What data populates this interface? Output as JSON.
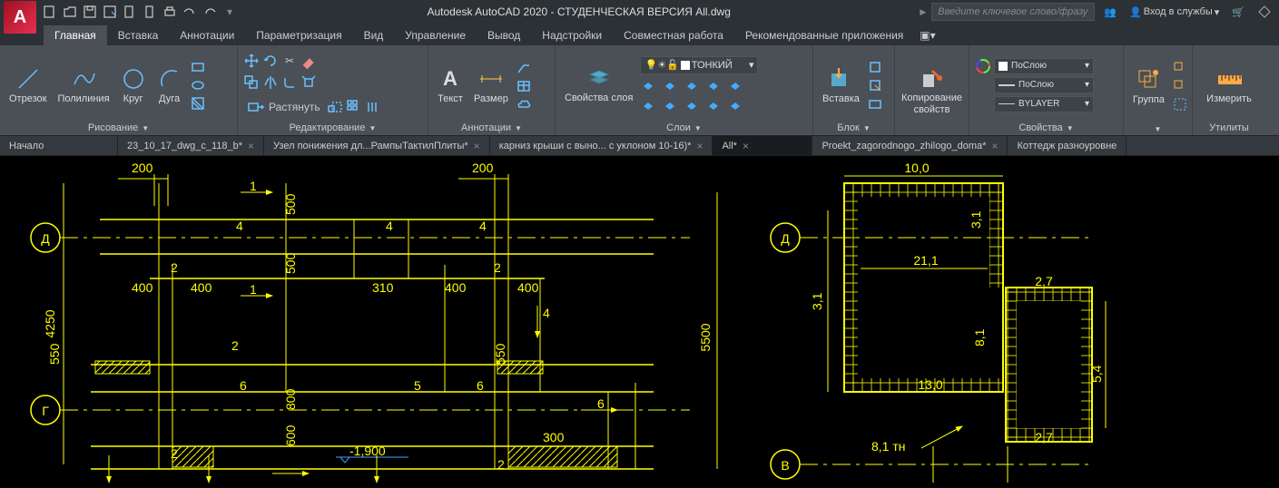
{
  "title": "Autodesk AutoCAD 2020 - СТУДЕНЧЕСКАЯ ВЕРСИЯ    All.dwg",
  "search_placeholder": "Введите ключевое слово/фразу",
  "login_label": "Вход в службы",
  "menu_tabs": [
    "Главная",
    "Вставка",
    "Аннотации",
    "Параметризация",
    "Вид",
    "Управление",
    "Вывод",
    "Надстройки",
    "Совместная работа",
    "Рекомендованные приложения"
  ],
  "panels": {
    "draw": {
      "title": "Рисование",
      "line": "Отрезок",
      "polyline": "Полилиния",
      "circle": "Круг",
      "arc": "Дуга"
    },
    "edit": {
      "title": "Редактирование",
      "stretch": "Растянуть"
    },
    "anno": {
      "title": "Аннотации",
      "text": "Текст",
      "dim": "Размер"
    },
    "layers": {
      "title": "Слои",
      "props": "Свойства слоя",
      "current": "ТОНКИЙ"
    },
    "insert": {
      "title": "Блок",
      "insert": "Вставка"
    },
    "clip": {
      "title": "",
      "copy": "Копирование свойств"
    },
    "props": {
      "title": "Свойства",
      "color": "ПоСлою",
      "ltype": "ПоСлою",
      "lweight": "BYLAYER"
    },
    "group": {
      "title": "",
      "group": "Группа"
    },
    "util": {
      "title": "Утилиты",
      "measure": "Измерить"
    }
  },
  "file_tabs": [
    {
      "label": "Начало",
      "close": false
    },
    {
      "label": "23_10_17_dwg_c_118_b*",
      "close": true
    },
    {
      "label": "Узел понижения дл...РампыТактилПлиты*",
      "close": true
    },
    {
      "label": "карниз крыши с выно... с уклоном 10-16)*",
      "close": true
    },
    {
      "label": "All*",
      "close": true,
      "active": true
    },
    {
      "label": "Proekt_zagorodnogo_zhilogo_doma*",
      "close": true
    },
    {
      "label": "Коттедж разноуровне",
      "close": false
    }
  ],
  "drawing": {
    "left_axes": [
      "Д",
      "Г"
    ],
    "right_axes": [
      "Д",
      "В"
    ],
    "dims_top_left": [
      "200",
      "200"
    ],
    "dims": {
      "d4": "4",
      "d1": "1",
      "d500": "500",
      "d2": "2",
      "d400": "400",
      "d310": "310",
      "d550": "550",
      "d4250": "4250",
      "d6": "6",
      "d5": "5",
      "d800": "800",
      "d600": "600",
      "d300": "300",
      "d5500": "5500",
      "d3_1": "3,1",
      "d10_0": "10,0",
      "d21_1": "21,1",
      "d2_7": "2,7",
      "d8_1": "8,1",
      "d13_0": "13,0",
      "d5_4": "5,4",
      "d8_1tn": "8,1 тн",
      "neg1900": "-1,900"
    }
  }
}
